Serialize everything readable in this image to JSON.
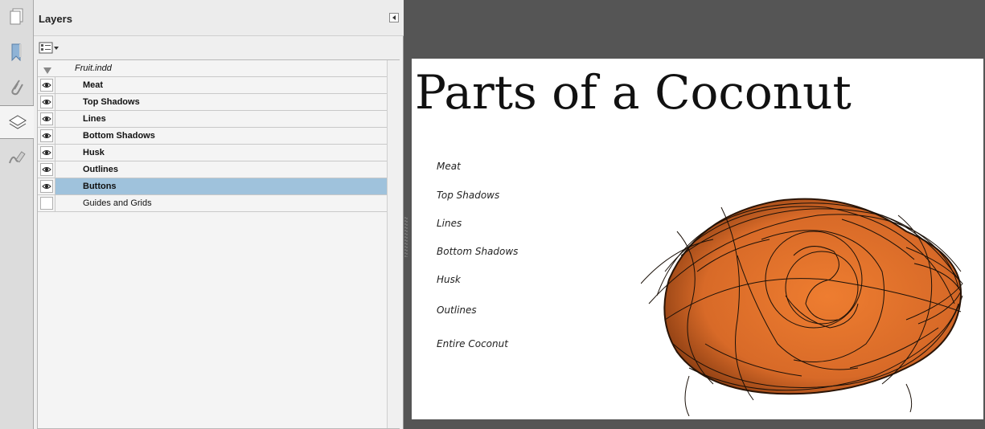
{
  "rail": {
    "icons": [
      "pages-icon",
      "bookmark-icon",
      "attachment-icon",
      "layers-icon",
      "signature-icon"
    ],
    "active": "layers-icon"
  },
  "panel": {
    "title": "Layers",
    "document_name": "Fruit.indd",
    "layers": [
      {
        "name": "Meat",
        "visible": true,
        "selected": false
      },
      {
        "name": "Top Shadows",
        "visible": true,
        "selected": false
      },
      {
        "name": "Lines",
        "visible": true,
        "selected": false
      },
      {
        "name": "Bottom Shadows",
        "visible": true,
        "selected": false
      },
      {
        "name": "Husk",
        "visible": true,
        "selected": false
      },
      {
        "name": "Outlines",
        "visible": true,
        "selected": false
      },
      {
        "name": "Buttons",
        "visible": true,
        "selected": true
      },
      {
        "name": "Guides and Grids",
        "visible": false,
        "selected": false
      }
    ]
  },
  "page": {
    "title": "Parts of a Coconut",
    "labels": [
      "Meat",
      "Top Shadows",
      "Lines",
      "Bottom Shadows",
      "Husk",
      "Outlines",
      "Entire Coconut"
    ]
  },
  "colors": {
    "selection": "#9fc2dc",
    "coconut_fill": "#e07a33",
    "coconut_husk": "#1a1008",
    "canvas_bg": "#555555"
  }
}
